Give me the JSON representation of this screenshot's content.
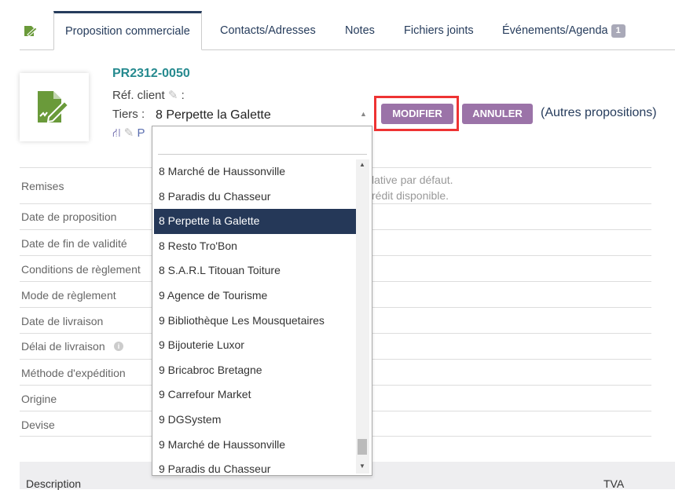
{
  "tabs": [
    {
      "label": "Proposition commerciale"
    },
    {
      "label": "Contacts/Adresses"
    },
    {
      "label": "Notes"
    },
    {
      "label": "Fichiers joints"
    },
    {
      "label": "Événements/Agenda",
      "badge": "1"
    }
  ],
  "header": {
    "ref": "PR2312-0050",
    "ref_client_label": "Réf. client",
    "colon": ":",
    "tiers_label": "Tiers :",
    "tiers_value": "8 Perpette la Galette",
    "project_partial": "P"
  },
  "buttons": {
    "modify": "MODIFIER",
    "cancel": "ANNULER",
    "other": "(Autres propositions)"
  },
  "dropdown": {
    "search": "",
    "items": [
      "8 Marché de Haussonville",
      "8 Paradis du Chasseur",
      "8 Perpette la Galette",
      "8 Resto Tro'Bon",
      "8 S.A.R.L Titouan Toiture",
      "9 Agence de Tourisme",
      "9 Bibliothèque Les Mousquetaires",
      "9 Bijouterie Luxor",
      "9 Bricabroc Bretagne",
      "9 Carrefour Market",
      "9 DGSystem",
      "9 Marché de Haussonville",
      "9 Paradis du Chasseur"
    ],
    "selected_index": 2
  },
  "fields": [
    "Remises",
    "Date de proposition",
    "Date de fin de validité",
    "Conditions de règlement",
    "Mode de règlement",
    "Date de livraison",
    "Délai de livraison",
    "Méthode d'expédition",
    "Origine",
    "Devise"
  ],
  "remises_text": [
    "lative par défaut.",
    "rédit disponible."
  ],
  "table": {
    "col1": "Description",
    "col2": "TVA"
  },
  "colors": {
    "accent": "#9b73a8",
    "nav": "#253858",
    "ref": "#268a8f",
    "logo": "#6a9a3a"
  }
}
